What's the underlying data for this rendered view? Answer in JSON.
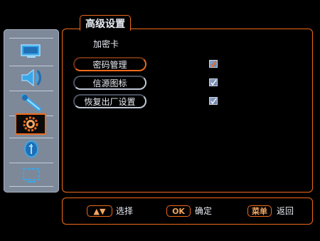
{
  "header": {
    "title": "高级设置"
  },
  "sidebar": {
    "items": [
      {
        "icon": "picture-icon"
      },
      {
        "icon": "audio-icon"
      },
      {
        "icon": "tools-icon"
      },
      {
        "icon": "advanced-settings-icon",
        "selected": true
      },
      {
        "icon": "info-icon"
      },
      {
        "icon": "source-icon"
      }
    ]
  },
  "main": {
    "section_label": "加密卡",
    "items": [
      {
        "label": "密码管理",
        "active": true,
        "checked": true
      },
      {
        "label": "信源图标",
        "active": false,
        "checked": true
      },
      {
        "label": "恢复出厂设置",
        "active": false,
        "checked": true
      }
    ]
  },
  "footer": {
    "select": {
      "key": "▲▼",
      "label": "选择"
    },
    "ok": {
      "key": "OK",
      "label": "确定"
    },
    "menu": {
      "key": "菜单",
      "label": "返回"
    }
  },
  "colors": {
    "accent": "#f06a1a",
    "sidebar_bg": "#7d8899",
    "icon": "#3aa7e8"
  }
}
